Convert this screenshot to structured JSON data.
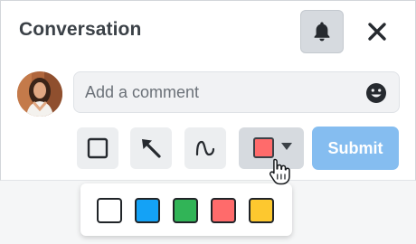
{
  "header": {
    "title": "Conversation",
    "bell_icon": "bell-icon",
    "close_icon": "close-icon"
  },
  "comment": {
    "placeholder": "Add a comment",
    "value": "",
    "emoji_icon": "smiley-icon"
  },
  "toolbar": {
    "tools": [
      {
        "name": "rectangle-tool",
        "icon": "square-outline-icon"
      },
      {
        "name": "arrow-tool",
        "icon": "arrow-up-left-icon"
      },
      {
        "name": "freehand-tool",
        "icon": "curve-icon"
      }
    ],
    "color_picker": {
      "selected_color": "#ff6b6b",
      "caret_icon": "caret-down-icon"
    },
    "submit_label": "Submit"
  },
  "palette": {
    "colors": [
      "#ffffff",
      "#14a2f6",
      "#31b457",
      "#ff6b6b",
      "#fdc82f"
    ]
  },
  "colors": {
    "submit_bg": "#85bdf0",
    "title_text": "#3b4147"
  }
}
